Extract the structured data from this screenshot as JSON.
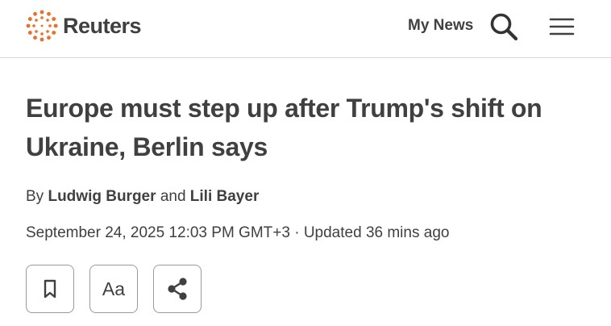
{
  "header": {
    "logo_text": "Reuters",
    "my_news_label": "My News",
    "search_icon": "search-icon",
    "menu_icon": "hamburger-menu-icon",
    "logo_color": "#f26c21"
  },
  "article": {
    "headline": "Europe must step up after Trump's shift on Ukraine, Berlin says",
    "byline_prefix": "By",
    "author_1": "Ludwig Burger",
    "byline_joiner": "and",
    "author_2": "Lili Bayer",
    "date": "September 24, 2025 12:03 PM GMT+3",
    "separator": "·",
    "updated": "Updated 36 mins ago"
  },
  "tools": {
    "bookmark_icon": "bookmark-icon",
    "font_size_label": "Aa",
    "share_icon": "share-icon"
  }
}
